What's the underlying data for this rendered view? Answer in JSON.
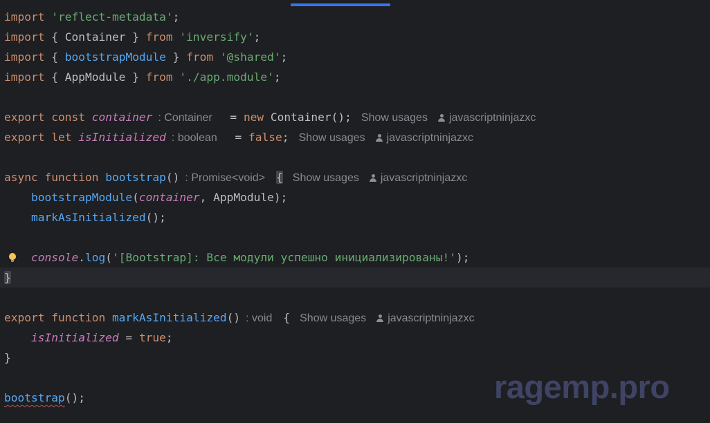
{
  "editor": {
    "l1": {
      "t1": "import",
      "t2": " ",
      "t3": "'reflect-metadata'",
      "t4": ";"
    },
    "l2": {
      "t1": "import",
      "t2": " { Container } ",
      "t3": "from",
      "t4": " ",
      "t5": "'inversify'",
      "t6": ";"
    },
    "l3": {
      "t1": "import",
      "t2": " { ",
      "t3": "bootstrapModule",
      "t4": " } ",
      "t5": "from",
      "t6": " ",
      "t7": "'@shared'",
      "t8": ";"
    },
    "l4": {
      "t1": "import",
      "t2": " { AppModule } ",
      "t3": "from",
      "t4": " ",
      "t5": "'./app.module'",
      "t6": ";"
    },
    "l6": {
      "t1": "export const",
      "t2": " ",
      "t3": "container",
      "hint": ": Container",
      "t4": " = ",
      "t5": "new",
      "t6": " Container();",
      "usages": "Show usages",
      "author": "javascriptninjazxc"
    },
    "l7": {
      "t1": "export let",
      "t2": " ",
      "t3": "isInitialized",
      "hint": ": boolean",
      "t4": " = ",
      "t5": "false",
      "t6": ";",
      "usages": "Show usages",
      "author": "javascriptninjazxc"
    },
    "l9": {
      "t1": "async function",
      "t2": " ",
      "t3": "bootstrap",
      "t4": "()",
      "hint": ": Promise<void>",
      "brace": "{",
      "usages": "Show usages",
      "author": "javascriptninjazxc"
    },
    "l10": {
      "indent": "    ",
      "t1": "bootstrapModule",
      "t2": "(",
      "t3": "container",
      "t4": ", AppModule);"
    },
    "l11": {
      "indent": "    ",
      "t1": "markAsInitialized",
      "t2": "();"
    },
    "l13": {
      "indent": "    ",
      "t1": "console",
      "t2": ".",
      "t3": "log",
      "t4": "(",
      "t5": "'[Bootstrap]: Все модули успешно инициализированы!'",
      "t6": ");"
    },
    "l14": {
      "brace": "}"
    },
    "l16": {
      "t1": "export function",
      "t2": " ",
      "t3": "markAsInitialized",
      "t4": "()",
      "hint": ": void",
      "brace": "{",
      "usages": "Show usages",
      "author": "javascriptninjazxc"
    },
    "l17": {
      "indent": "    ",
      "t1": "isInitialized",
      "t2": " = ",
      "t3": "true",
      "t4": ";"
    },
    "l18": {
      "t1": "}"
    },
    "l20": {
      "t1": "bootstrap",
      "t2": "();"
    }
  },
  "watermark": "ragemp.pro",
  "icons": {
    "intention": "lightbulb-icon",
    "author": "user-icon"
  },
  "colors": {
    "background": "#1e1f22",
    "keyword": "#cf8e6d",
    "string": "#6aab73",
    "function": "#56a8f5",
    "property": "#c77dbb",
    "text": "#bcbec4",
    "hint": "#868a91"
  }
}
